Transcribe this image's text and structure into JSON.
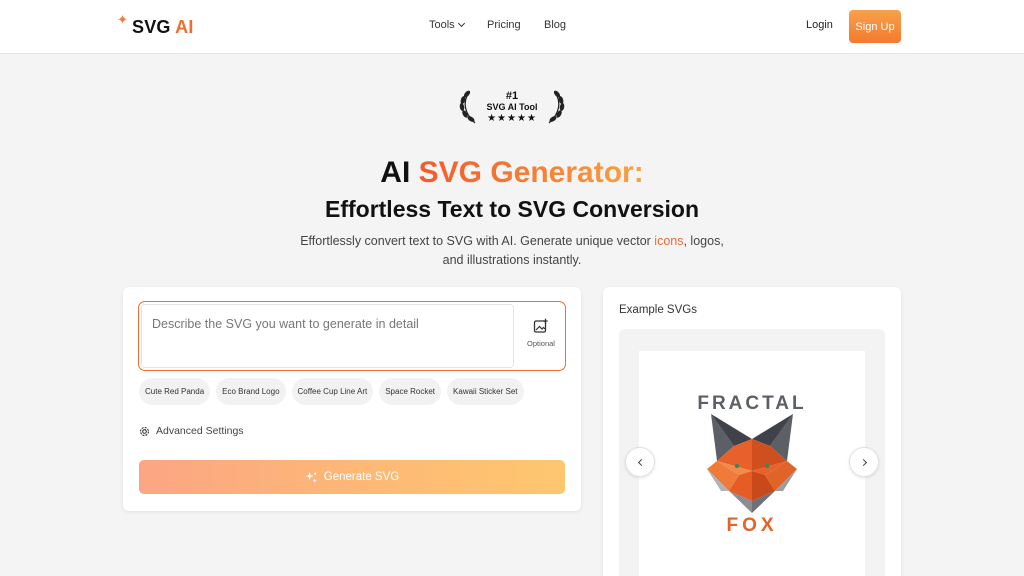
{
  "nav": {
    "logo_part1": "SVG",
    "logo_part2": "AI",
    "links": [
      "Tools",
      "Pricing",
      "Blog"
    ],
    "login": "Login",
    "signup": "Sign Up"
  },
  "badge": {
    "rank": "#1",
    "label": "SVG AI Tool",
    "stars": "★★★★★"
  },
  "hero": {
    "title_part1": "AI ",
    "title_part2": "SVG Generator:",
    "subtitle": "Effortless Text to SVG Conversion",
    "desc_part1": "Effortlessly convert text to SVG with AI. Generate unique vector ",
    "desc_link": "icons",
    "desc_part2": ", logos, and illustrations instantly."
  },
  "generator": {
    "placeholder": "Describe the SVG you want to generate in detail",
    "optional_label": "Optional",
    "chips": [
      "Cute Red Panda",
      "Eco Brand Logo",
      "Coffee Cup Line Art",
      "Space Rocket",
      "Kawaii Sticker Set"
    ],
    "advanced_label": "Advanced Settings",
    "generate_label": "Generate SVG"
  },
  "examples": {
    "title": "Example SVGs",
    "logo_top": "FRACTAL",
    "logo_bottom": "FOX"
  },
  "colors": {
    "accent": "#f26b2f",
    "accent_light": "#f8a23f",
    "fox_orange": "#e8602a",
    "fox_gray": "#5c5f66"
  }
}
